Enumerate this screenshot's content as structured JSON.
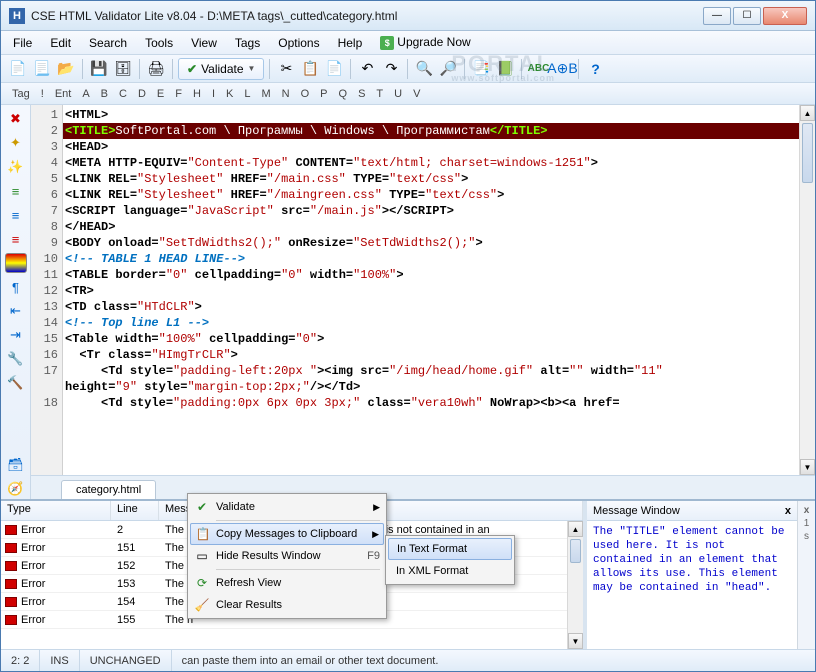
{
  "titlebar": {
    "title": "CSE HTML Validator Lite v8.04 - D:\\META tags\\_cutted\\category.html"
  },
  "menu": {
    "items": [
      "File",
      "Edit",
      "Search",
      "Tools",
      "View",
      "Tags",
      "Options",
      "Help"
    ],
    "upgrade": "Upgrade Now"
  },
  "toolbar": {
    "validate": "Validate"
  },
  "letterbar": {
    "prefix": [
      "Tag",
      "!",
      "Ent"
    ],
    "letters": [
      "A",
      "B",
      "C",
      "D",
      "E",
      "F",
      "H",
      "I",
      "K",
      "L",
      "M",
      "N",
      "O",
      "P",
      "Q",
      "S",
      "T",
      "U",
      "V"
    ]
  },
  "code": {
    "lines": [
      {
        "n": 1,
        "html": "<span class='tag-b'>&lt;HTML&gt;</span>"
      },
      {
        "n": 2,
        "cls": "line2",
        "html": "<span class='tag-b'>&lt;TITLE&gt;</span><span class='txt'>SoftPortal.com \\ Программы \\ Windows \\ Программистам</span><span class='tag-b'>&lt;/TITLE&gt;</span>"
      },
      {
        "n": 3,
        "html": "<span class='tag-b'>&lt;HEAD&gt;</span>"
      },
      {
        "n": 4,
        "html": "<span class='tag-b'>&lt;META</span> <span class='attr'>HTTP-EQUIV=</span><span class='val'>\"Content-Type\"</span> <span class='attr'>CONTENT=</span><span class='val'>\"text/html; charset=windows-1251\"</span><span class='tag-b'>&gt;</span>"
      },
      {
        "n": 5,
        "html": "<span class='tag-b'>&lt;LINK</span> <span class='attr'>REL=</span><span class='val'>\"Stylesheet\"</span> <span class='attr'>HREF=</span><span class='val'>\"/main.css\"</span> <span class='attr'>TYPE=</span><span class='val'>\"text/css\"</span><span class='tag-b'>&gt;</span>"
      },
      {
        "n": 6,
        "html": "<span class='tag-b'>&lt;LINK</span> <span class='attr'>REL=</span><span class='val'>\"Stylesheet\"</span> <span class='attr'>HREF=</span><span class='val'>\"/maingreen.css\"</span> <span class='attr'>TYPE=</span><span class='val'>\"text/css\"</span><span class='tag-b'>&gt;</span>"
      },
      {
        "n": 7,
        "html": "<span class='tag-b'>&lt;SCRIPT</span> <span class='attr'>language=</span><span class='val'>\"JavaScript\"</span> <span class='attr'>src=</span><span class='val'>\"/main.js\"</span><span class='tag-b'>&gt;&lt;/SCRIPT&gt;</span>"
      },
      {
        "n": 8,
        "html": "<span class='tag-b'>&lt;/HEAD&gt;</span>"
      },
      {
        "n": 9,
        "html": "<span class='tag-b'>&lt;BODY</span> <span class='attr'>onload=</span><span class='val'>\"SetTdWidths2();\"</span> <span class='attr'>onResize=</span><span class='val'>\"SetTdWidths2();\"</span><span class='tag-b'>&gt;</span>"
      },
      {
        "n": 10,
        "html": "<span class='cmt'>&lt;!-- TABLE 1 HEAD LINE--&gt;</span>"
      },
      {
        "n": 11,
        "html": "<span class='tag-b'>&lt;TABLE</span> <span class='attr'>border=</span><span class='val'>\"0\"</span> <span class='attr'>cellpadding=</span><span class='val'>\"0\"</span> <span class='attr'>width=</span><span class='val'>\"100%\"</span><span class='tag-b'>&gt;</span>"
      },
      {
        "n": 12,
        "html": "<span class='tag-b'>&lt;TR&gt;</span>"
      },
      {
        "n": 13,
        "html": "<span class='tag-b'>&lt;TD</span> <span class='attr'>class=</span><span class='val'>\"HTdCLR\"</span><span class='tag-b'>&gt;</span>"
      },
      {
        "n": 14,
        "html": "<span class='cmt'>&lt;!-- Top line L1 --&gt;</span>"
      },
      {
        "n": 15,
        "html": "<span class='tag-b'>&lt;Table</span> <span class='attr'>width=</span><span class='val'>\"100%\"</span> <span class='attr'>cellpadding=</span><span class='val'>\"0\"</span><span class='tag-b'>&gt;</span>"
      },
      {
        "n": 16,
        "html": "  <span class='tag-b'>&lt;Tr</span> <span class='attr'>class=</span><span class='val'>\"HImgTrCLR\"</span><span class='tag-b'>&gt;</span>"
      },
      {
        "n": 17,
        "html": "     <span class='tag-b'>&lt;Td</span> <span class='attr'>style=</span><span class='val'>\"padding-left:20px \"</span><span class='tag-b'>&gt;&lt;img</span> <span class='attr'>src=</span><span class='val'>\"/img/head/home.gif\"</span> <span class='attr'>alt=</span><span class='val'>\"\"</span> <span class='attr'>width=</span><span class='val'>\"11\"</span>"
      },
      {
        "n": "",
        "html": "<span class='attr'>height=</span><span class='val'>\"9\"</span> <span class='attr'>style=</span><span class='val'>\"margin-top:2px;\"</span><span class='tag-b'>/&gt;&lt;/Td&gt;</span>"
      },
      {
        "n": 18,
        "html": "     <span class='tag-b'>&lt;Td</span> <span class='attr'>style=</span><span class='val'>\"padding:0px 6px 0px 3px;\"</span> <span class='attr'>class=</span><span class='val'>\"vera10wh\"</span> <span class='attr'>NoWrap</span><span class='tag-b'>&gt;&lt;b&gt;&lt;a</span> <span class='attr'>href=</span>"
      }
    ]
  },
  "filetab": {
    "name": "category.html"
  },
  "results": {
    "headers": {
      "type": "Type",
      "line": "Line",
      "message": "Message"
    },
    "rows": [
      {
        "type": "Error",
        "line": "2",
        "msg": "The \"TITLE\" element cannot be used here. It is not contained in an"
      },
      {
        "type": "Error",
        "line": "151",
        "msg": "The h                                             \" attribute is missing"
      },
      {
        "type": "Error",
        "line": "152",
        "msg": "The h"
      },
      {
        "type": "Error",
        "line": "153",
        "msg": "The h"
      },
      {
        "type": "Error",
        "line": "154",
        "msg": "The h"
      },
      {
        "type": "Error",
        "line": "155",
        "msg": "The h"
      }
    ]
  },
  "context_menu": {
    "validate": "Validate",
    "copy": "Copy Messages to Clipboard",
    "hide": "Hide Results Window",
    "hide_key": "F9",
    "refresh": "Refresh View",
    "clear": "Clear Results"
  },
  "submenu": {
    "text": "In Text Format",
    "xml": "In XML Format"
  },
  "msg_window": {
    "title": "Message Window",
    "body": "The \"TITLE\" element cannot be used here. It is not contained in an element that allows its use. This element may be contained in \"head\"."
  },
  "statusbar": {
    "pos": "2: 2",
    "ins": "INS",
    "state": "UNCHANGED",
    "hint": "can paste them into an email or other text document."
  },
  "watermark": {
    "main": "PORTAL",
    "sub": "www.softportal.com"
  }
}
